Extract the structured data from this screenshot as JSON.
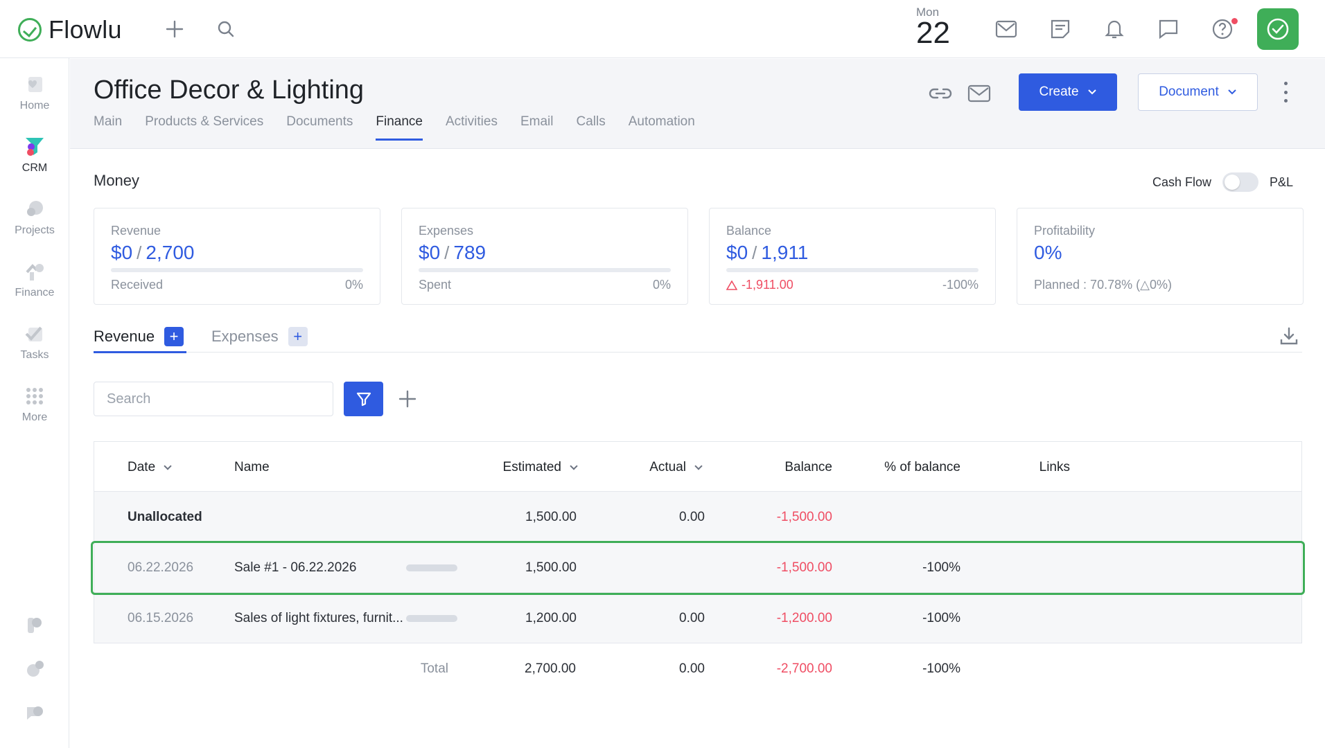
{
  "app": {
    "brand": "Flowlu"
  },
  "topbar": {
    "date_day": "Mon",
    "date_num": "22"
  },
  "sidebar": {
    "items": [
      {
        "label": "Home",
        "icon": "home-icon"
      },
      {
        "label": "CRM",
        "icon": "crm-funnel-icon"
      },
      {
        "label": "Projects",
        "icon": "projects-icon"
      },
      {
        "label": "Finance",
        "icon": "finance-icon"
      },
      {
        "label": "Tasks",
        "icon": "tasks-icon"
      },
      {
        "label": "More",
        "icon": "grid-icon"
      }
    ]
  },
  "page": {
    "title": "Office Decor & Lighting",
    "tabs": [
      "Main",
      "Products & Services",
      "Documents",
      "Finance",
      "Activities",
      "Email",
      "Calls",
      "Automation"
    ],
    "active_tab": "Finance",
    "create_label": "Create",
    "document_label": "Document"
  },
  "money": {
    "title": "Money",
    "toggle_left": "Cash Flow",
    "toggle_right": "P&L",
    "cards": [
      {
        "label": "Revenue",
        "value_a": "$0",
        "value_b": "2,700",
        "foot_l": "Received",
        "foot_r": "0%",
        "progress": 0
      },
      {
        "label": "Expenses",
        "value_a": "$0",
        "value_b": "789",
        "foot_l": "Spent",
        "foot_r": "0%",
        "progress": 0
      },
      {
        "label": "Balance",
        "value_a": "$0",
        "value_b": "1,911",
        "foot_l": "-1,911.00",
        "foot_r": "-100%",
        "progress": 0
      },
      {
        "label": "Profitability",
        "value_a": "0%",
        "foot_l": "Planned : 70.78% (△0%)"
      }
    ]
  },
  "subtabs": {
    "revenue": "Revenue",
    "expenses": "Expenses"
  },
  "search": {
    "placeholder": "Search"
  },
  "table": {
    "headers": {
      "date": "Date",
      "name": "Name",
      "estimated": "Estimated",
      "actual": "Actual",
      "balance": "Balance",
      "pct": "% of balance",
      "links": "Links"
    },
    "unallocated": {
      "label": "Unallocated",
      "estimated": "1,500.00",
      "actual": "0.00",
      "balance": "-1,500.00"
    },
    "rows": [
      {
        "date": "06.22.2026",
        "name": "Sale #1 - 06.22.2026",
        "estimated": "1,500.00",
        "actual": "",
        "balance": "-1,500.00",
        "pct": "-100%"
      },
      {
        "date": "06.15.2026",
        "name": "Sales of light fixtures, furnit...",
        "estimated": "1,200.00",
        "actual": "0.00",
        "balance": "-1,200.00",
        "pct": "-100%"
      }
    ],
    "total": {
      "label": "Total",
      "estimated": "2,700.00",
      "actual": "0.00",
      "balance": "-2,700.00",
      "pct": "-100%"
    }
  },
  "colors": {
    "accent": "#2f5be0",
    "brand_green": "#3fae58",
    "negative": "#ef4d63"
  }
}
